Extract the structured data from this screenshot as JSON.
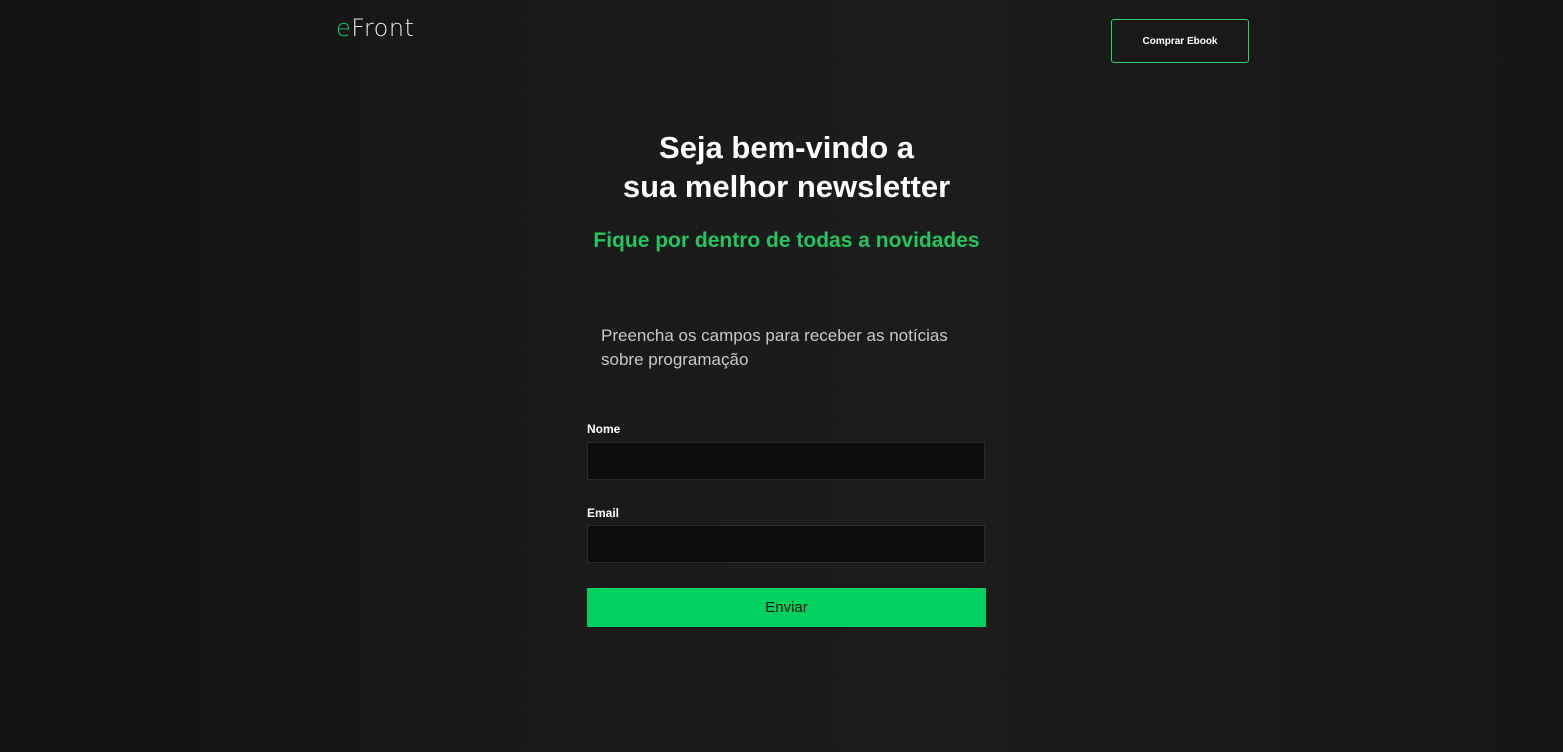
{
  "header": {
    "logo_accent": "e",
    "logo_rest": "Front",
    "buy_button": "Comprar Ebook"
  },
  "hero": {
    "title_line1": "Seja bem-vindo a",
    "title_line2": "sua melhor newsletter",
    "subtitle": "Fique por dentro de todas a novidades"
  },
  "form": {
    "intro": "Preencha os campos para receber as notícias sobre programação",
    "name_label": "Nome",
    "name_value": "",
    "name_placeholder": "",
    "email_label": "Email",
    "email_value": "",
    "email_placeholder": "",
    "submit_label": "Enviar"
  },
  "colors": {
    "accent": "#22c55e",
    "button": "#00d15f",
    "background": "#161616"
  }
}
